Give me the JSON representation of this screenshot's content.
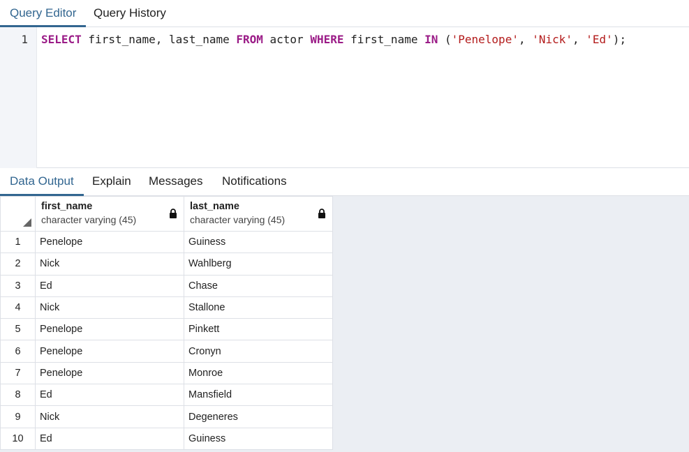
{
  "editor_tabs": [
    "Query Editor",
    "Query History"
  ],
  "editor": {
    "line_number": "1",
    "sql": {
      "kw_select": "SELECT",
      "cols": " first_name, last_name ",
      "kw_from": "FROM",
      "table": " actor ",
      "kw_where": "WHERE",
      "col": " first_name ",
      "kw_in": "IN",
      "open": " (",
      "s1": "'Penelope'",
      "sep1": ", ",
      "s2": "'Nick'",
      "sep2": ", ",
      "s3": "'Ed'",
      "close": ");"
    }
  },
  "output_tabs": [
    "Data Output",
    "Explain",
    "Messages",
    "Notifications"
  ],
  "columns": [
    {
      "name": "first_name",
      "type": "character varying (45)"
    },
    {
      "name": "last_name",
      "type": "character varying (45)"
    }
  ],
  "rows": [
    {
      "n": "1",
      "first": "Penelope",
      "last": "Guiness"
    },
    {
      "n": "2",
      "first": "Nick",
      "last": "Wahlberg"
    },
    {
      "n": "3",
      "first": "Ed",
      "last": "Chase"
    },
    {
      "n": "4",
      "first": "Nick",
      "last": "Stallone"
    },
    {
      "n": "5",
      "first": "Penelope",
      "last": "Pinkett"
    },
    {
      "n": "6",
      "first": "Penelope",
      "last": "Cronyn"
    },
    {
      "n": "7",
      "first": "Penelope",
      "last": "Monroe"
    },
    {
      "n": "8",
      "first": "Ed",
      "last": "Mansfield"
    },
    {
      "n": "9",
      "first": "Nick",
      "last": "Degeneres"
    },
    {
      "n": "10",
      "first": "Ed",
      "last": "Guiness"
    }
  ],
  "colors": {
    "accent": "#326690",
    "keyword": "#9b1c87",
    "string": "#b31b1b",
    "grid_bg": "#ebeef3"
  },
  "icons": {
    "column_lock": "lock-icon",
    "sort_corner": "corner-triangle-icon"
  }
}
